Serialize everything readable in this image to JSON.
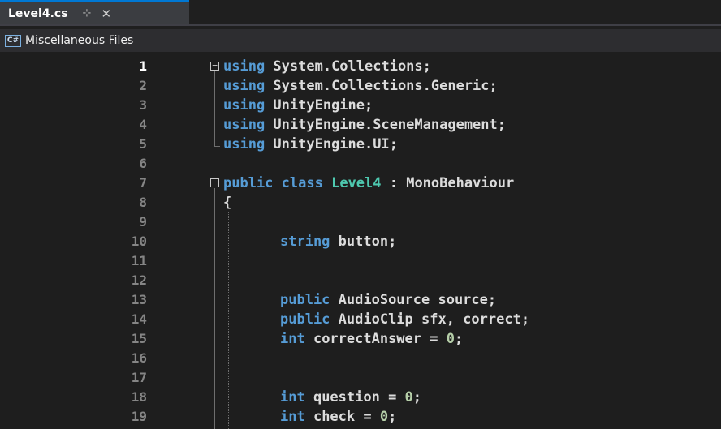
{
  "tab": {
    "title": "Level4.cs",
    "pin_glyph": "⊹",
    "close_glyph": "✕"
  },
  "nav": {
    "badge": "C#",
    "label": "Miscellaneous Files"
  },
  "code": {
    "line_numbers": [
      "1",
      "2",
      "3",
      "4",
      "5",
      "6",
      "7",
      "8",
      "9",
      "10",
      "11",
      "12",
      "13",
      "14",
      "15",
      "16",
      "17",
      "18",
      "19"
    ],
    "l1_using": "using",
    "l1_rest": " System.Collections;",
    "l2_using": "using",
    "l2_rest": " System.Collections.Generic;",
    "l3_using": "using",
    "l3_rest": " UnityEngine;",
    "l4_using": "using",
    "l4_rest": " UnityEngine.SceneManagement;",
    "l5_using": "using",
    "l5_rest": " UnityEngine.UI;",
    "l7_public": "public",
    "l7_class": " class ",
    "l7_name": "Level4",
    "l7_rest": " : MonoBehaviour",
    "l8_brace": "{",
    "l10_type": "string",
    "l10_rest": " button;",
    "l13_public": "public",
    "l13_rest": " AudioSource source;",
    "l14_public": "public",
    "l14_rest": " AudioClip sfx, correct;",
    "l15_int": "int",
    "l15_mid": " correctAnswer = ",
    "l15_num": "0",
    "l15_end": ";",
    "l18_int": "int",
    "l18_mid": " question = ",
    "l18_num": "0",
    "l18_end": ";",
    "l19_int": "int",
    "l19_mid": " check = ",
    "l19_num": "0",
    "l19_end": ";"
  },
  "colors": {
    "keyword": "#569cd6",
    "type": "#4ec9b0",
    "number": "#b5cea8",
    "text": "#dcdcdc",
    "tab_accent": "#0078d4"
  }
}
